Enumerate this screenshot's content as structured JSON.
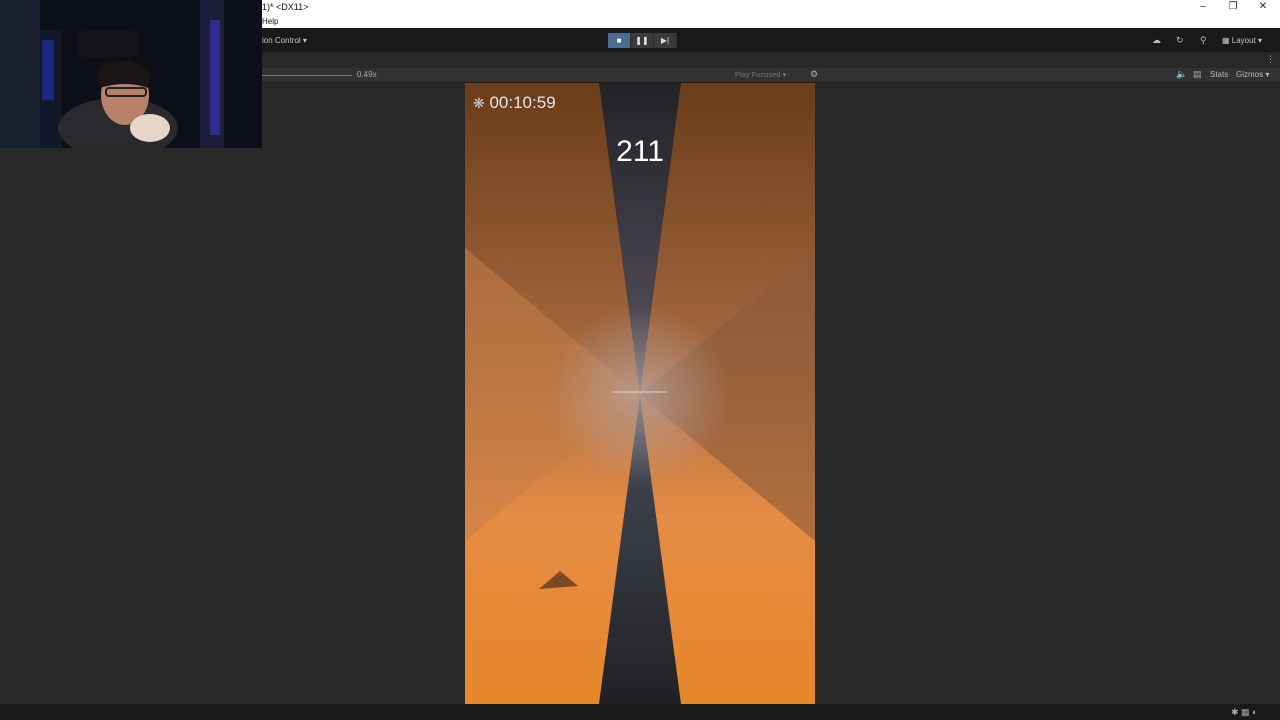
{
  "window": {
    "title": "1)* <DX11>"
  },
  "menu": {
    "help": "Help"
  },
  "toolbar": {
    "version_control": "ion Control ▾",
    "layout_label": "Layout"
  },
  "gameview": {
    "scale_label": "0.49x",
    "play_mode_label": "Play Focused",
    "stats_label": "Stats",
    "gizmos_label": "Gizmos"
  },
  "game": {
    "timer": "00:10:59",
    "score": "211"
  },
  "colors": {
    "accent_play": "#4b6a94",
    "orange_top": "#6b3f1c",
    "orange_bottom": "#e58a2b",
    "dark_beam": "#25252c"
  },
  "icons": [
    "minimize-icon",
    "restore-icon",
    "close-icon",
    "stop-icon",
    "pause-icon",
    "step-icon",
    "cloud-icon",
    "history-icon",
    "search-icon",
    "layout-icon",
    "kebab-menu-icon",
    "speaker-icon",
    "display-icon",
    "gear-icon",
    "status-icons"
  ]
}
